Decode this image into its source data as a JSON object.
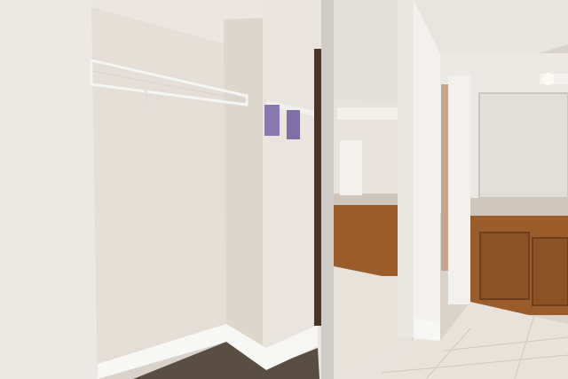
{
  "scene": {
    "description_alt": "",
    "colors": {
      "wall_light": "#ece8e3",
      "wall_shadow": "#d6d0c8",
      "closet_inner": "#e2dcd4",
      "ceiling": "#ebe7e2",
      "ceiling_texture": "#dcd6cf",
      "baseboard": "#f7f7f5",
      "carpet": "#5a4d42",
      "tile": "#e7e2da",
      "tile_grout": "#cfc8be",
      "cabinet": "#9a5c2a",
      "cabinet_dark": "#7a4520",
      "countertop": "#cfc7bb",
      "mirror_frame": "#c9c6c2",
      "door_trim": "#f2f1ee",
      "sachet": "#8878b0",
      "light_bulb": "#fbfaf3",
      "bedroom_wall": "#c7a48d"
    }
  }
}
